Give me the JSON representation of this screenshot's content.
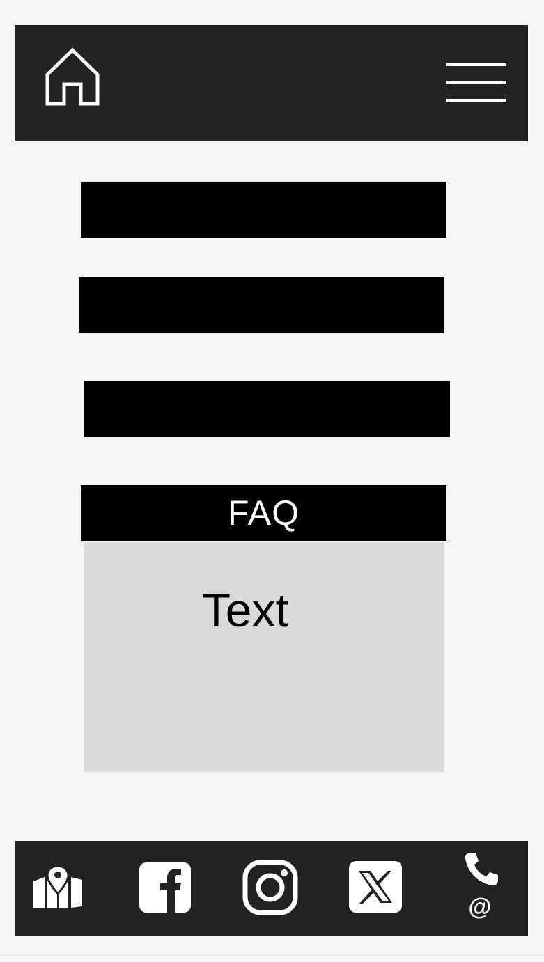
{
  "header": {
    "home_icon": "home-icon",
    "menu_icon": "hamburger-menu-icon"
  },
  "nav": {
    "items": [
      {
        "label": ""
      },
      {
        "label": ""
      },
      {
        "label": ""
      }
    ]
  },
  "faq": {
    "title": "FAQ",
    "body_text": "Text"
  },
  "footer": {
    "icons": [
      "map-icon",
      "facebook-icon",
      "instagram-icon",
      "x-icon",
      "phone-icon"
    ],
    "contact_at": "@"
  },
  "colors": {
    "header_bg": "#222222",
    "page_bg": "#f4f4f4",
    "nav_bar": "#000000",
    "faq_body": "#d9d9d9",
    "icon": "#ffffff"
  }
}
